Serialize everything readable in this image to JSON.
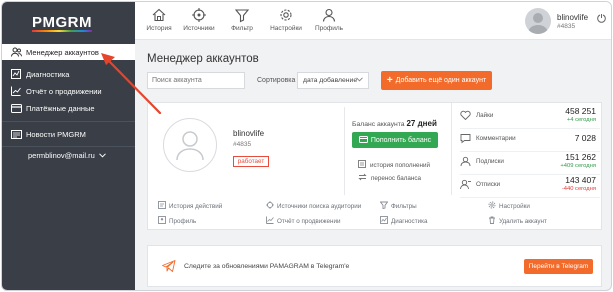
{
  "brand": {
    "logo": "PMGRM"
  },
  "sidebar": {
    "items": [
      {
        "label": "Менеджер аккаунтов",
        "icon": "accounts-icon"
      },
      {
        "label": "Диагностика",
        "icon": "diagnostics-icon"
      },
      {
        "label": "Отчёт о продвижении",
        "icon": "report-icon"
      },
      {
        "label": "Платёжные данные",
        "icon": "payment-icon"
      },
      {
        "label": "Новости PMGRM",
        "icon": "news-icon"
      }
    ],
    "user_email": "permblinov@mail.ru"
  },
  "topnav": {
    "items": [
      {
        "label": "История",
        "icon": "home-icon"
      },
      {
        "label": "Источники",
        "icon": "target-icon"
      },
      {
        "label": "Фильтр",
        "icon": "filter-icon"
      },
      {
        "label": "Настройки",
        "icon": "gear-icon"
      },
      {
        "label": "Профиль",
        "icon": "user-icon"
      }
    ],
    "account_name": "blinovlife",
    "account_id": "#4835"
  },
  "main": {
    "title": "Менеджер аккаунтов",
    "search_placeholder": "Поиск аккаунта",
    "sort_label": "Сортировка",
    "sort_value": "дата добавление",
    "add_button": "Добавить ещё один аккаунт"
  },
  "account": {
    "name": "blinovlife",
    "id": "#4835",
    "status": "работает",
    "balance_label": "Баланс аккаунта",
    "balance_value": "27 дней",
    "topup_button": "Пополнить баланс",
    "history_link": "история пополнений",
    "transfer_link": "перенос баланса"
  },
  "stats": [
    {
      "label": "Лайки",
      "value": "458 251",
      "delta": "+4 сегодня",
      "trend": "pos",
      "icon": "heart-icon"
    },
    {
      "label": "Комментарии",
      "value": "7 028",
      "delta": "",
      "trend": "",
      "icon": "comment-icon"
    },
    {
      "label": "Подписки",
      "value": "151 262",
      "delta": "+409 сегодня",
      "trend": "pos",
      "icon": "subscribe-icon"
    },
    {
      "label": "Отписки",
      "value": "143 407",
      "delta": "-440 сегодня",
      "trend": "neg",
      "icon": "unsubscribe-icon"
    }
  ],
  "actions": {
    "row1": [
      "История действий",
      "Источники поиска аудитории",
      "Фильтры",
      "Настройки"
    ],
    "row2": [
      "Профиль",
      "Отчёт о продвижении",
      "Диагностика",
      "Удалить аккаунт"
    ]
  },
  "telegram": {
    "text": "Следите за обновлениями PAMAGRAM в Telegram'e",
    "button": "Перейти в Telegram"
  },
  "colors": {
    "sidebar_bg": "#3a3f47",
    "accent_orange": "#f26b2a",
    "accent_green": "#32a852",
    "status_red": "#e74c3c",
    "arrow_red": "#e5452c"
  }
}
